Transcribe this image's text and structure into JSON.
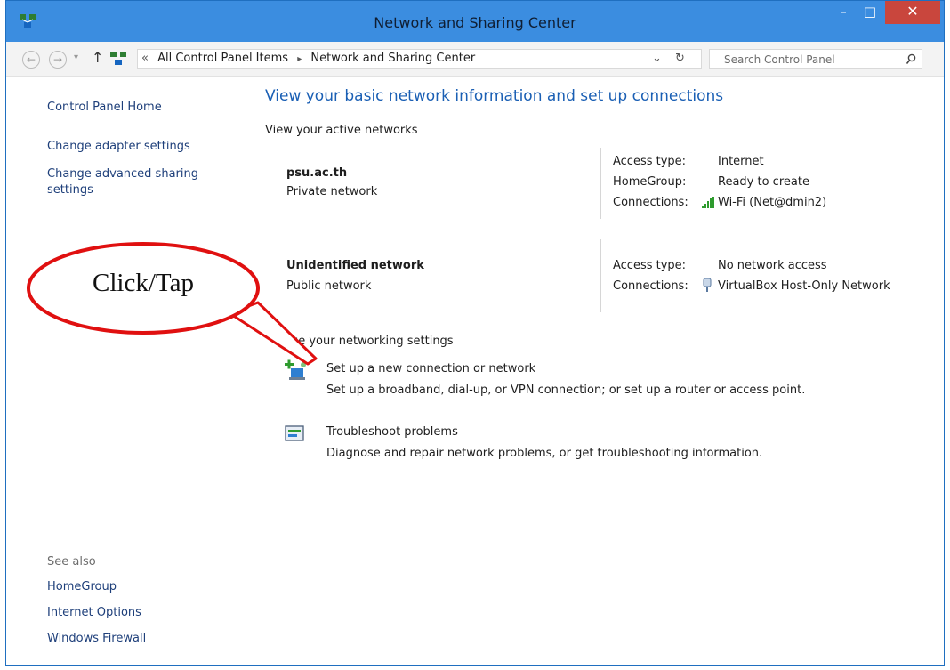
{
  "window": {
    "title": "Network and Sharing Center",
    "minimize": "–",
    "maximize": "□",
    "close": "✕"
  },
  "address": {
    "overflow": "«",
    "crumbs": [
      "All Control Panel Items",
      "Network and Sharing Center"
    ],
    "separator": "▸",
    "dropdown": "⌄",
    "refresh": "↻"
  },
  "search": {
    "placeholder": "Search Control Panel"
  },
  "sidebar": {
    "home": "Control Panel Home",
    "links": [
      "Change adapter settings",
      "Change advanced sharing settings"
    ],
    "see_also": "See also",
    "see_also_links": [
      "HomeGroup",
      "Internet Options",
      "Windows Firewall"
    ]
  },
  "main": {
    "heading": "View your basic network information and set up connections",
    "active_header": "View your active networks",
    "networks": [
      {
        "name": "psu.ac.th",
        "category": "Private network",
        "access_label": "Access type:",
        "access_value": "Internet",
        "homegroup_label": "HomeGroup:",
        "homegroup_value": "Ready to create",
        "connections_label": "Connections:",
        "connection_value": "Wi-Fi (Net@dmin2)",
        "connection_icon": "wifi-signal-icon"
      },
      {
        "name": "Unidentified network",
        "category": "Public network",
        "access_label": "Access type:",
        "access_value": "No network access",
        "connections_label": "Connections:",
        "connection_value": "VirtualBox Host-Only Network",
        "connection_icon": "ethernet-plug-icon"
      }
    ],
    "settings_header": "age your networking settings",
    "tasks": [
      {
        "title": "Set up a new connection or network",
        "desc": "Set up a broadband, dial-up, or VPN connection; or set up a router or access point.",
        "icon": "new-connection-icon"
      },
      {
        "title": "Troubleshoot problems",
        "desc": "Diagnose and repair network problems, or get troubleshooting information.",
        "icon": "troubleshoot-icon"
      }
    ]
  },
  "callout": {
    "text": "Click/Tap",
    "color": "#e01010"
  },
  "colors": {
    "titlebar": "#3b8de0",
    "link": "#1a62b8",
    "heading": "#1a5fb4",
    "close": "#c9463d"
  }
}
